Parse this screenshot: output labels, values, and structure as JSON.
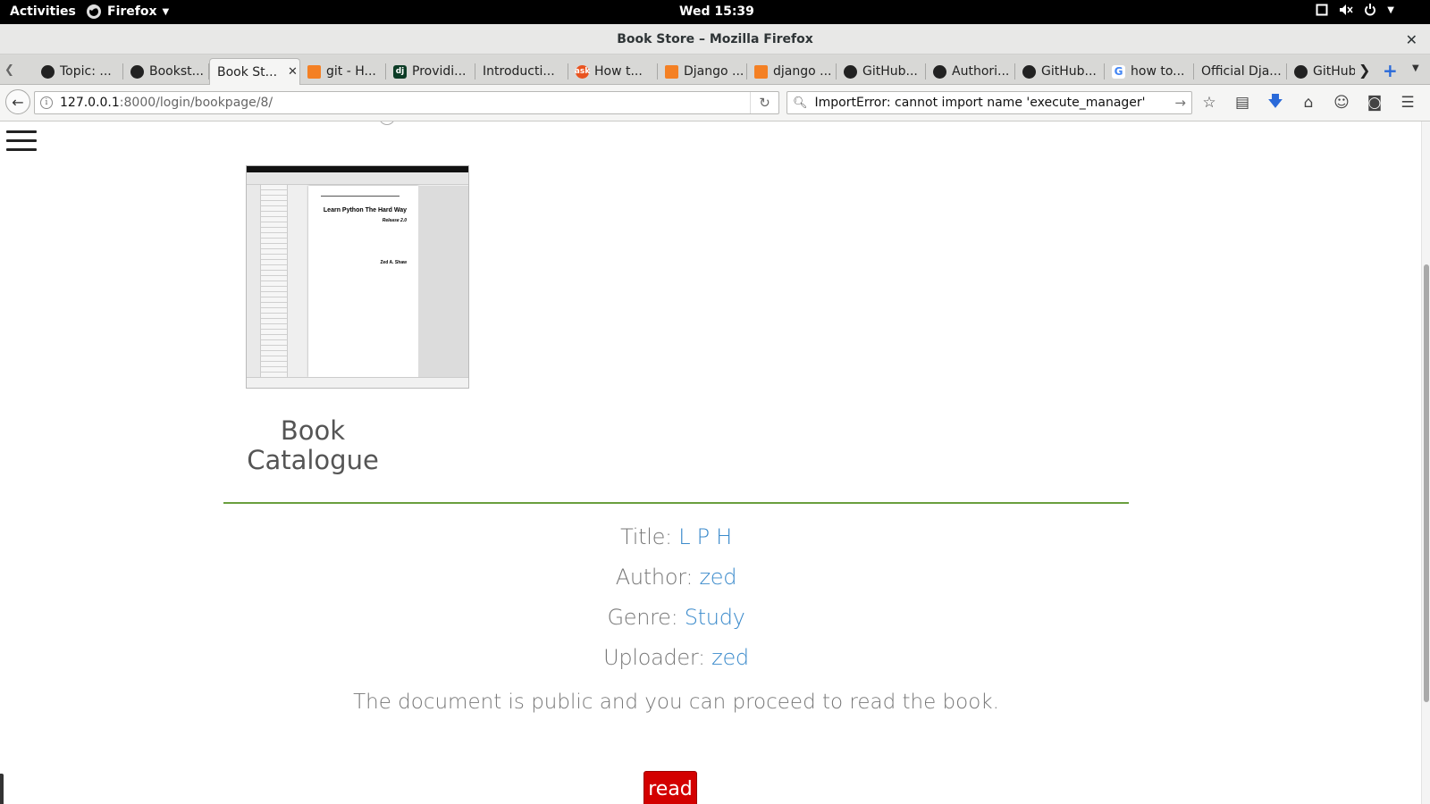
{
  "system_bar": {
    "activities": "Activities",
    "app_name": "Firefox",
    "clock": "Wed 15:39"
  },
  "window": {
    "title": "Book Store – Mozilla Firefox"
  },
  "tabs": [
    {
      "label": "Topic: ...",
      "icon": "github-icon"
    },
    {
      "label": "Bookst...",
      "icon": "github-icon"
    },
    {
      "label": "Book St...",
      "icon": "none",
      "active": true
    },
    {
      "label": "git - H...",
      "icon": "stackoverflow-icon"
    },
    {
      "label": "Providi...",
      "icon": "django-icon"
    },
    {
      "label": "Introducti...",
      "icon": "none"
    },
    {
      "label": "How t...",
      "icon": "askubuntu-icon"
    },
    {
      "label": "Django ...",
      "icon": "stackoverflow-icon"
    },
    {
      "label": "django ...",
      "icon": "stackoverflow-icon"
    },
    {
      "label": "GitHub...",
      "icon": "github-icon"
    },
    {
      "label": "Authori...",
      "icon": "github-icon"
    },
    {
      "label": "GitHub...",
      "icon": "github-icon"
    },
    {
      "label": "how to...",
      "icon": "google-icon"
    },
    {
      "label": "Official Dja...",
      "icon": "none"
    },
    {
      "label": "GitHub",
      "icon": "github-icon"
    }
  ],
  "navbar": {
    "url_host": "127.0.0.1",
    "url_path": ":8000/login/bookpage/8/",
    "search_value": "ImportError: cannot import name 'execute_manager'"
  },
  "cover": {
    "title": "Learn Python The Hard Way",
    "release": "Release 2.0",
    "author": "Zed A. Shaw"
  },
  "page": {
    "heading": "Book Catalogue",
    "title_label": "Title:",
    "title_value": "L P H",
    "author_label": "Author:",
    "author_value": "zed",
    "genre_label": "Genre:",
    "genre_value": "Study",
    "uploader_label": "Uploader:",
    "uploader_value": "zed",
    "notice": "The document is public and you can proceed to read the book.",
    "read_button": "read"
  },
  "colors": {
    "accent_link": "#3a8acb",
    "divider": "#6a9f3e",
    "read_button": "#d30000"
  }
}
